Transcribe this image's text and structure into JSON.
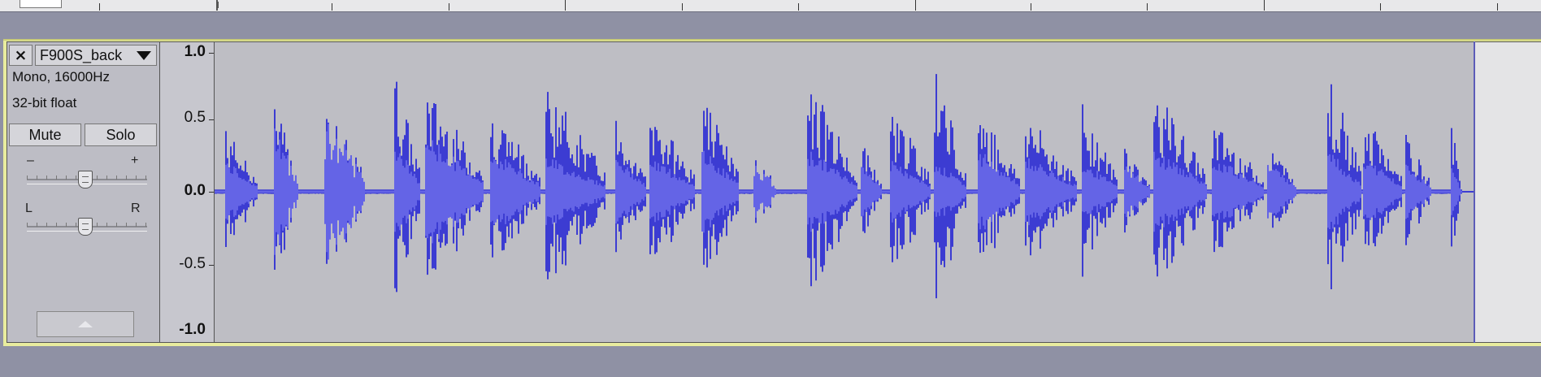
{
  "track": {
    "name": "F900S_back",
    "close_label": "×",
    "format": "Mono, 16000Hz",
    "sample_format": "32-bit float",
    "mute_label": "Mute",
    "solo_label": "Solo",
    "gain_minus": "–",
    "gain_plus": "+",
    "pan_left": "L",
    "pan_right": "R",
    "gain_level": 0.5,
    "pan_level": 0.5
  },
  "vertical_ruler": {
    "labels": [
      "1.0",
      "0.5",
      "0.0",
      "-0.5",
      "-1.0"
    ]
  },
  "colors": {
    "waveform_peak": "#3c3cd2",
    "waveform_rms": "#6464e6",
    "background": "#bebec4",
    "track_border": "#e8ec9e"
  },
  "icons": {
    "close": "close-icon",
    "dropdown": "chevron-down-icon",
    "collapse": "chevron-up-icon"
  }
}
